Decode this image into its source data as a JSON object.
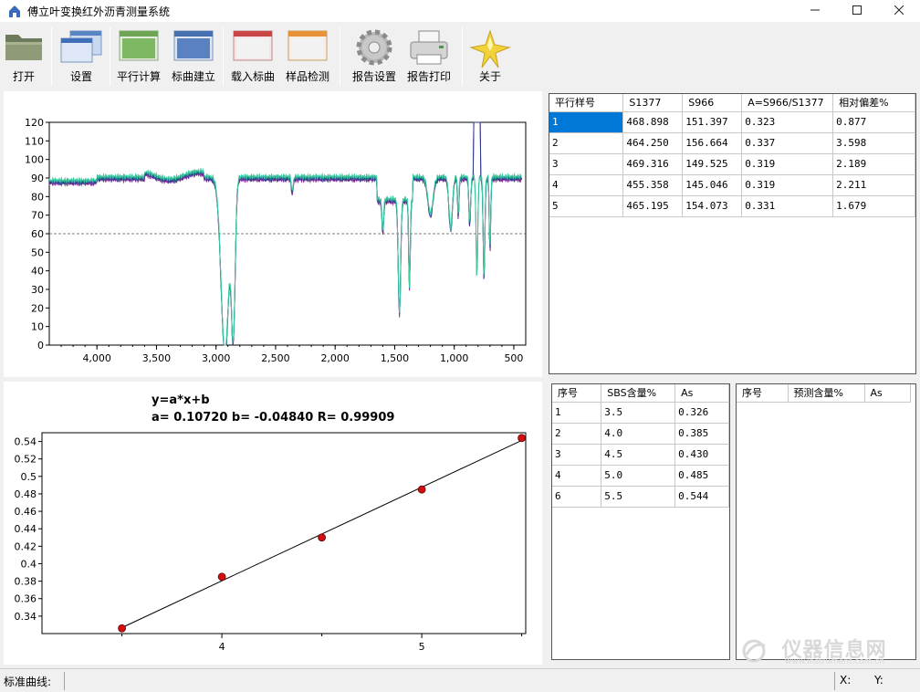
{
  "window": {
    "title": "傅立叶变换红外沥青测量系统",
    "minimize": "minimize",
    "maximize": "maximize",
    "close": "close"
  },
  "toolbar": {
    "items": [
      {
        "label": "打开",
        "icon": "folder-icon"
      },
      {
        "label": "设置",
        "icon": "windows-icon"
      },
      {
        "label": "平行计算",
        "icon": "green-window-icon"
      },
      {
        "label": "标曲建立",
        "icon": "blue-window-icon"
      },
      {
        "label": "载入标曲",
        "icon": "red-window-icon"
      },
      {
        "label": "样品检测",
        "icon": "orange-window-icon"
      },
      {
        "label": "报告设置",
        "icon": "gear-icon"
      },
      {
        "label": "报告打印",
        "icon": "printer-icon"
      },
      {
        "label": "关于",
        "icon": "star-icon"
      }
    ]
  },
  "spectrum_chart": {
    "type": "line",
    "x_ticks": [
      "4,000",
      "3,500",
      "3,000",
      "2,500",
      "2,000",
      "1,500",
      "1,000",
      "500"
    ],
    "y_ticks": [
      "0",
      "10",
      "20",
      "30",
      "40",
      "50",
      "60",
      "70",
      "80",
      "90",
      "100",
      "110",
      "120"
    ],
    "xlim": [
      4400,
      400
    ],
    "ylim": [
      0,
      120
    ],
    "reference_line_y": 60,
    "colors": {
      "main": "#3cc9a0",
      "alt": "#1f8a8a",
      "dark": "#2a3a8a",
      "accent": "#8a2a9a"
    }
  },
  "parallel_table": {
    "headers": [
      "平行样号",
      "S1377",
      "S966",
      "A=S966/S1377",
      "相对偏差%"
    ],
    "rows": [
      [
        "1",
        "468.898",
        "151.397",
        "0.323",
        "0.877"
      ],
      [
        "2",
        "464.250",
        "156.664",
        "0.337",
        "3.598"
      ],
      [
        "3",
        "469.316",
        "149.525",
        "0.319",
        "2.189"
      ],
      [
        "4",
        "455.358",
        "145.046",
        "0.319",
        "2.211"
      ],
      [
        "5",
        "465.195",
        "154.073",
        "0.331",
        "1.679"
      ]
    ]
  },
  "calib_table": {
    "headers": [
      "序号",
      "SBS含量%",
      "As"
    ],
    "rows": [
      [
        "1",
        "3.5",
        "0.326"
      ],
      [
        "2",
        "4.0",
        "0.385"
      ],
      [
        "3",
        "4.5",
        "0.430"
      ],
      [
        "4",
        "5.0",
        "0.485"
      ],
      [
        "6",
        "5.5",
        "0.544"
      ]
    ]
  },
  "predict_table": {
    "headers": [
      "序号",
      "预测含量%",
      "As"
    ],
    "rows": []
  },
  "calibration_chart": {
    "type": "scatter",
    "equation": "y=a*x+b",
    "params": "a= 0.10720  b= -0.04840  R= 0.99909",
    "x": [
      3.5,
      4.0,
      4.5,
      5.0,
      5.5
    ],
    "y": [
      0.326,
      0.385,
      0.43,
      0.485,
      0.544
    ],
    "fit": {
      "a": 0.1072,
      "b": -0.0484
    },
    "x_ticks": [
      "4",
      "5"
    ],
    "y_ticks": [
      "0.34",
      "0.36",
      "0.38",
      "0.4",
      "0.42",
      "0.44",
      "0.46",
      "0.48",
      "0.5",
      "0.52",
      "0.54"
    ],
    "xlim": [
      3.1,
      5.52
    ],
    "ylim": [
      0.32,
      0.55
    ],
    "point_color": "#d01010"
  },
  "status": {
    "label": "标准曲线:",
    "x_label": "X:",
    "y_label": "Y:"
  },
  "watermark": {
    "text": "仪器信息网",
    "sub": "www.instrument.com.cn"
  }
}
